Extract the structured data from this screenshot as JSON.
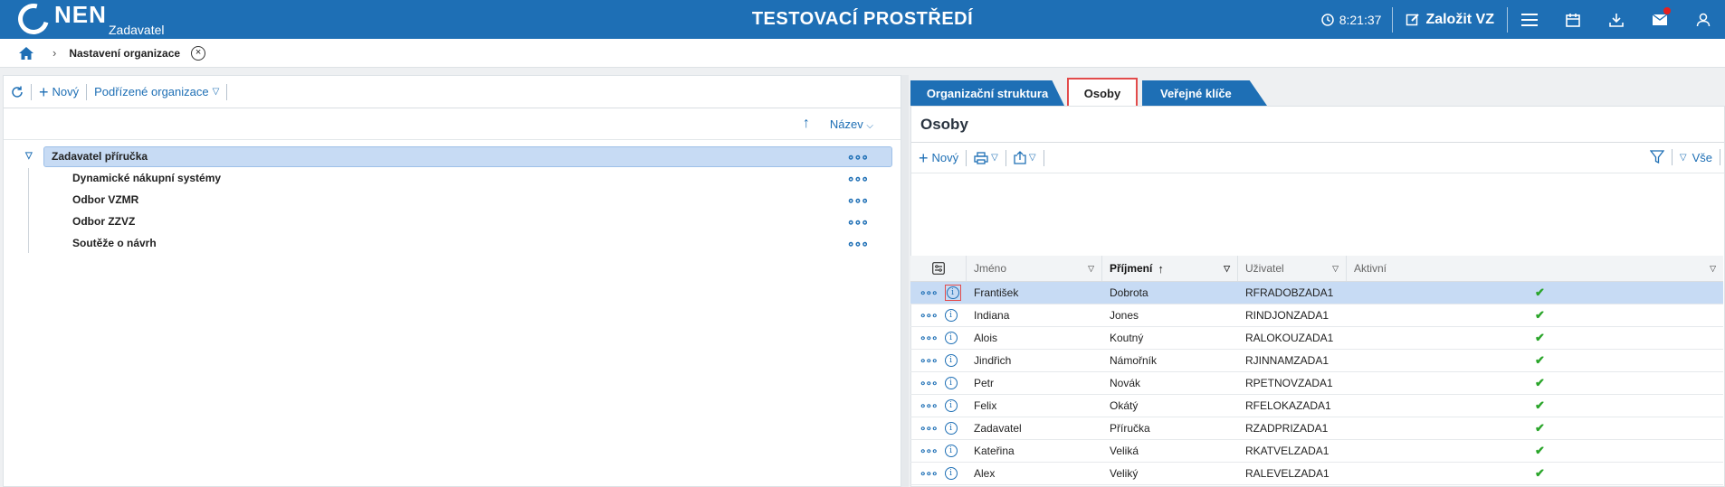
{
  "app": {
    "logo_text": "NEN",
    "logo_subtitle": "Zadavatel",
    "environment_title": "TESTOVACÍ PROSTŘEDÍ"
  },
  "header": {
    "time": "8:21:37",
    "create_label": "Založit VZ"
  },
  "breadcrumb": {
    "current": "Nastavení organizace"
  },
  "left": {
    "toolbar": {
      "new_label": "Nový",
      "subordinate_label": "Podřízené organizace"
    },
    "sort": {
      "label": "Název"
    },
    "tree": {
      "root": "Zadavatel příručka",
      "children": [
        "Dynamické nákupní systémy",
        "Odbor VZMR",
        "Odbor ZZVZ",
        "Soutěže o návrh"
      ]
    }
  },
  "tabs": [
    "Organizační struktura",
    "Osoby",
    "Veřejné klíče"
  ],
  "right": {
    "title": "Osoby",
    "toolbar": {
      "new_label": "Nový",
      "filter_label": "Vše"
    },
    "columns": [
      "Jméno",
      "Příjmení",
      "Uživatel",
      "Aktivní"
    ],
    "rows": [
      {
        "first": "František",
        "last": "Dobrota",
        "user": "RFRADOBZADA1",
        "active": "✔"
      },
      {
        "first": "Indiana",
        "last": "Jones",
        "user": "RINDJONZADA1",
        "active": "✔"
      },
      {
        "first": "Alois",
        "last": "Koutný",
        "user": "RALOKOUZADA1",
        "active": "✔"
      },
      {
        "first": "Jindřich",
        "last": "Námořník",
        "user": "RJINNAMZADA1",
        "active": "✔"
      },
      {
        "first": "Petr",
        "last": "Novák",
        "user": "RPETNOVZADA1",
        "active": "✔"
      },
      {
        "first": "Felix",
        "last": "Okátý",
        "user": "RFELOKAZADA1",
        "active": "✔"
      },
      {
        "first": "Zadavatel",
        "last": "Příručka",
        "user": "RZADPRIZADA1",
        "active": "✔"
      },
      {
        "first": "Kateřina",
        "last": "Veliká",
        "user": "RKATVELZADA1",
        "active": "✔"
      },
      {
        "first": "Alex",
        "last": "Veliký",
        "user": "RALEVELZADA1",
        "active": "✔"
      }
    ]
  },
  "colors": {
    "primary": "#1e6fb5",
    "selected_row": "#c7dbf4",
    "highlight_border": "#e24b4b",
    "check": "#2aa52a"
  }
}
